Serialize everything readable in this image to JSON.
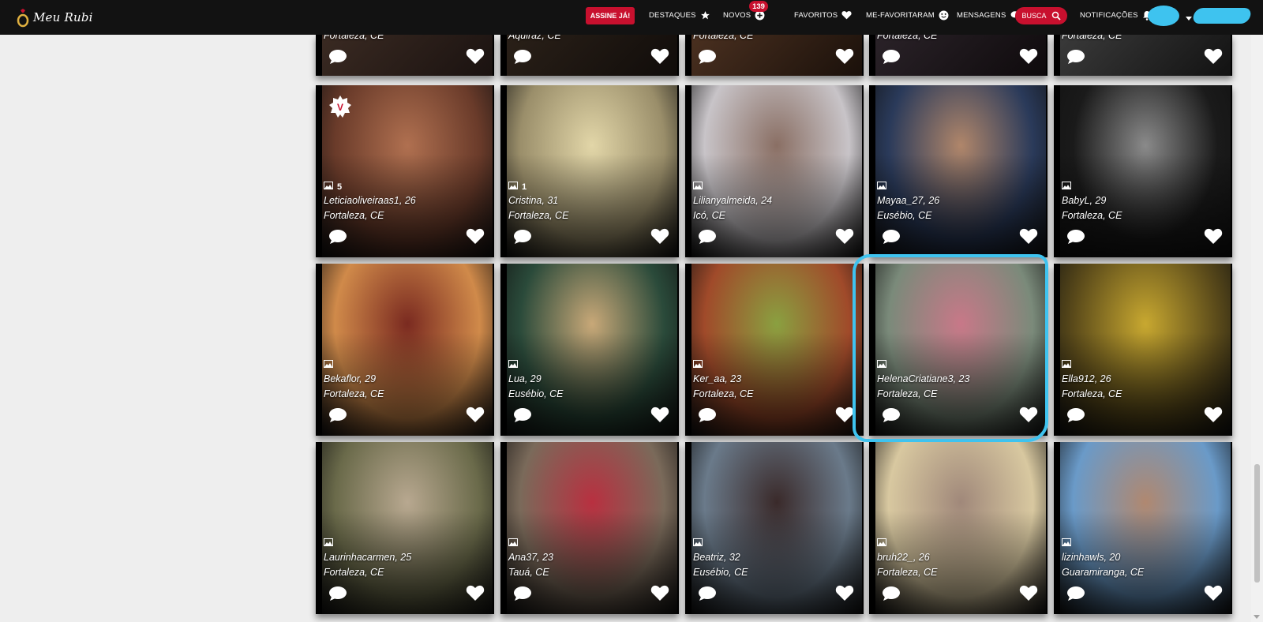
{
  "brand": {
    "logo_text": "Meu Rubi"
  },
  "nav": {
    "subscribe_label": "ASSINE JÁ!",
    "destaques_label": "DESTAQUES",
    "novos_label": "NOVOS",
    "novos_badge": "139",
    "favoritos_label": "FAVORITOS",
    "me_favoritaram_label": "ME-FAVORITARAM",
    "mensagens_label": "MENSAGENS",
    "busca_label": "BUSCA",
    "notificacoes_label": "NOTIFICAÇÕES"
  },
  "top_row": [
    {
      "city": "Fortaleza, CE"
    },
    {
      "city": "Aquiraz, CE"
    },
    {
      "city": "Fortaleza, CE"
    },
    {
      "city": "Fortaleza, CE"
    },
    {
      "city": "Fortaleza, CE"
    }
  ],
  "row1": [
    {
      "name": "Leticiaoliveiraas1, 26",
      "city": "Fortaleza, CE",
      "photos": "5",
      "vip": "V",
      "colors": [
        "#6a3b2a",
        "#b07050"
      ]
    },
    {
      "name": "Cristina, 31",
      "city": "Fortaleza, CE",
      "photos": "1",
      "colors": [
        "#9a8e6a",
        "#e2d6a8"
      ]
    },
    {
      "name": "Lilianyalmeida, 24",
      "city": "Icó, CE",
      "photos": "",
      "colors": [
        "#c8c4c8",
        "#8a6f64"
      ]
    },
    {
      "name": "Mayaa_27, 26",
      "city": "Eusébio, CE",
      "photos": "",
      "colors": [
        "#2a3a5a",
        "#b0866a"
      ]
    },
    {
      "name": "BabyL, 29",
      "city": "Fortaleza, CE",
      "photos": "",
      "colors": [
        "#1a1a1a",
        "#8a8a8a"
      ]
    }
  ],
  "row2": [
    {
      "name": "Bekaflor, 29",
      "city": "Fortaleza, CE",
      "colors": [
        "#d08a4a",
        "#7a2a20"
      ]
    },
    {
      "name": "Lua, 29",
      "city": "Eusébio, CE",
      "colors": [
        "#2a4a3a",
        "#c8a878"
      ]
    },
    {
      "name": "Ker_aa, 23",
      "city": "Fortaleza, CE",
      "colors": [
        "#a04a2a",
        "#8aa040"
      ]
    },
    {
      "name": "HelenaCriatiane3, 23",
      "city": "Fortaleza, CE",
      "colors": [
        "#7a8a7a",
        "#c87888"
      ]
    },
    {
      "name": "Ella912, 26",
      "city": "Fortaleza, CE",
      "colors": [
        "#5a4a1a",
        "#c8a830"
      ]
    }
  ],
  "row3": [
    {
      "name": "Laurinhacarmen, 25",
      "city": "Fortaleza, CE",
      "colors": [
        "#6a6a4a",
        "#b8a890"
      ]
    },
    {
      "name": "Ana37, 23",
      "city": "Tauá, CE",
      "colors": [
        "#7a6a5a",
        "#b83040"
      ]
    },
    {
      "name": "Beatriz, 32",
      "city": "Eusébio, CE",
      "colors": [
        "#6a7a8a",
        "#3a2a2a"
      ]
    },
    {
      "name": "bruh22_, 26",
      "city": "Fortaleza, CE",
      "colors": [
        "#d8c8a0",
        "#a0887a"
      ]
    },
    {
      "name": "lizinhawls, 20",
      "city": "Guaramiranga, CE",
      "colors": [
        "#6a9ac8",
        "#b08870"
      ]
    }
  ],
  "accent_color": "#c8102e",
  "highlight_color": "#3ec3ef"
}
